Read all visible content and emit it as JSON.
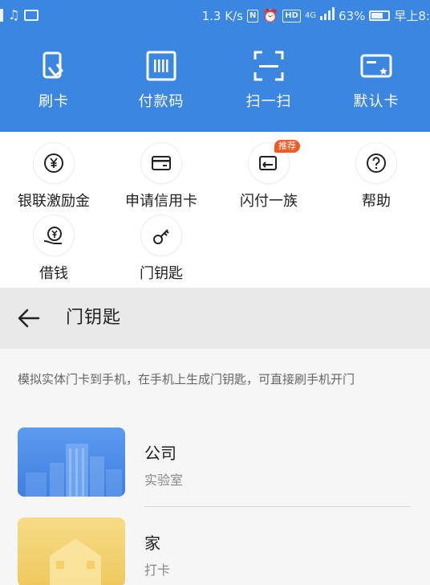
{
  "status_bar": {
    "speed": "1.3 K/s",
    "network": "4G",
    "hd": "HD",
    "battery": "63%",
    "time": "早上8:"
  },
  "top_actions": [
    {
      "label": "刷卡",
      "icon": "card-swipe-icon"
    },
    {
      "label": "付款码",
      "icon": "payment-code-icon"
    },
    {
      "label": "扫一扫",
      "icon": "scan-icon"
    },
    {
      "label": "默认卡",
      "icon": "default-card-icon"
    }
  ],
  "quick_items": [
    {
      "label": "银联激励金",
      "icon": "yuan-coin-icon"
    },
    {
      "label": "申请信用卡",
      "icon": "credit-card-icon"
    },
    {
      "label": "闪付一族",
      "icon": "quickpass-icon",
      "badge": "推荐"
    },
    {
      "label": "帮助",
      "icon": "help-icon"
    },
    {
      "label": "借钱",
      "icon": "borrow-money-icon"
    },
    {
      "label": "门钥匙",
      "icon": "key-icon"
    }
  ],
  "key_page": {
    "title": "门钥匙",
    "description": "模拟实体门卡到手机，在手机上生成门钥匙，可直接刷手机开门",
    "cards": [
      {
        "name": "公司",
        "sub": "实验室",
        "color": "#4a8be8"
      },
      {
        "name": "家",
        "sub": "打卡",
        "color": "#f3d06a"
      }
    ]
  },
  "colors": {
    "primary_blue": "#3b86e0",
    "badge_orange": "#f25a24"
  }
}
